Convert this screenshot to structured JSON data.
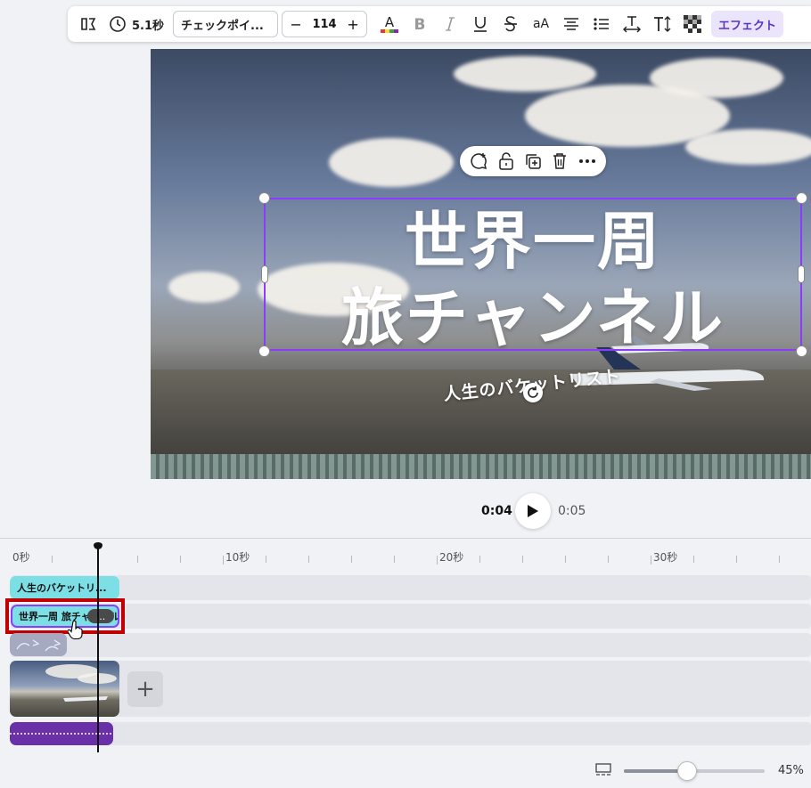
{
  "toolbar": {
    "duration": "5.1秒",
    "font_name": "チェックポイ...",
    "font_size": "114",
    "minus": "−",
    "plus": "+",
    "case_label": "aA",
    "effect_label": "エフェクト",
    "text_color": "#6d28d9"
  },
  "canvas": {
    "title_line1": "世界一周",
    "title_line2": "旅チャンネル",
    "subtitle": "人生のバケットリスト",
    "selection_color": "#8b3dff"
  },
  "playback": {
    "current": "0:04",
    "total": "0:05"
  },
  "timeline": {
    "ticks": [
      "0秒",
      "10秒",
      "20秒",
      "30秒"
    ],
    "clips": {
      "subtitle_clip": "人生のバケットリ...",
      "title_clip": "世界一周 旅チャンネル",
      "more": "..."
    },
    "add_label": "+"
  },
  "zoom": {
    "value_label": "45%",
    "level": 0.45
  }
}
